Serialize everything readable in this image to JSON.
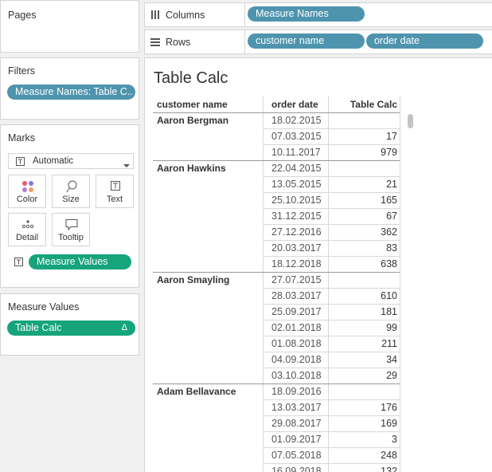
{
  "pages": {
    "title": "Pages"
  },
  "filters": {
    "title": "Filters",
    "pills": [
      {
        "label": "Measure Names: Table C.."
      }
    ]
  },
  "marks": {
    "title": "Marks",
    "type_selected": "Automatic",
    "buttons": [
      {
        "label": "Color",
        "icon": "color-dots-icon"
      },
      {
        "label": "Size",
        "icon": "size-lasso-icon"
      },
      {
        "label": "Text",
        "icon": "text-t-icon"
      },
      {
        "label": "Detail",
        "icon": "detail-dots-icon"
      },
      {
        "label": "Tooltip",
        "icon": "tooltip-bubble-icon"
      }
    ],
    "field_pill": {
      "label": "Measure Values",
      "icon": "text-t-icon"
    }
  },
  "measure_values": {
    "title": "Measure Values",
    "pills": [
      {
        "label": "Table Calc",
        "badge": "Δ"
      }
    ]
  },
  "shelves": {
    "columns": {
      "label": "Columns",
      "icon": "columns-icon",
      "pills": [
        "Measure Names"
      ]
    },
    "rows": {
      "label": "Rows",
      "icon": "rows-icon",
      "pills": [
        "customer name",
        "order date"
      ]
    }
  },
  "view": {
    "title": "Table Calc",
    "headers": {
      "customer": "customer name",
      "date": "order date",
      "value": "Table Calc"
    },
    "groups": [
      {
        "customer": "Aaron Bergman",
        "rows": [
          {
            "date": "18.02.2015",
            "value": ""
          },
          {
            "date": "07.03.2015",
            "value": "17"
          },
          {
            "date": "10.11.2017",
            "value": "979"
          }
        ]
      },
      {
        "customer": "Aaron Hawkins",
        "rows": [
          {
            "date": "22.04.2015",
            "value": ""
          },
          {
            "date": "13.05.2015",
            "value": "21"
          },
          {
            "date": "25.10.2015",
            "value": "165"
          },
          {
            "date": "31.12.2015",
            "value": "67"
          },
          {
            "date": "27.12.2016",
            "value": "362"
          },
          {
            "date": "20.03.2017",
            "value": "83"
          },
          {
            "date": "18.12.2018",
            "value": "638"
          }
        ]
      },
      {
        "customer": "Aaron Smayling",
        "rows": [
          {
            "date": "27.07.2015",
            "value": ""
          },
          {
            "date": "28.03.2017",
            "value": "610"
          },
          {
            "date": "25.09.2017",
            "value": "181"
          },
          {
            "date": "02.01.2018",
            "value": "99"
          },
          {
            "date": "01.08.2018",
            "value": "211"
          },
          {
            "date": "04.09.2018",
            "value": "34"
          },
          {
            "date": "03.10.2018",
            "value": "29"
          }
        ]
      },
      {
        "customer": "Adam Bellavance",
        "rows": [
          {
            "date": "18.09.2016",
            "value": ""
          },
          {
            "date": "13.03.2017",
            "value": "176"
          },
          {
            "date": "29.08.2017",
            "value": "169"
          },
          {
            "date": "01.09.2017",
            "value": "3"
          },
          {
            "date": "07.05.2018",
            "value": "248"
          },
          {
            "date": "16.09.2018",
            "value": "132"
          }
        ]
      }
    ]
  }
}
